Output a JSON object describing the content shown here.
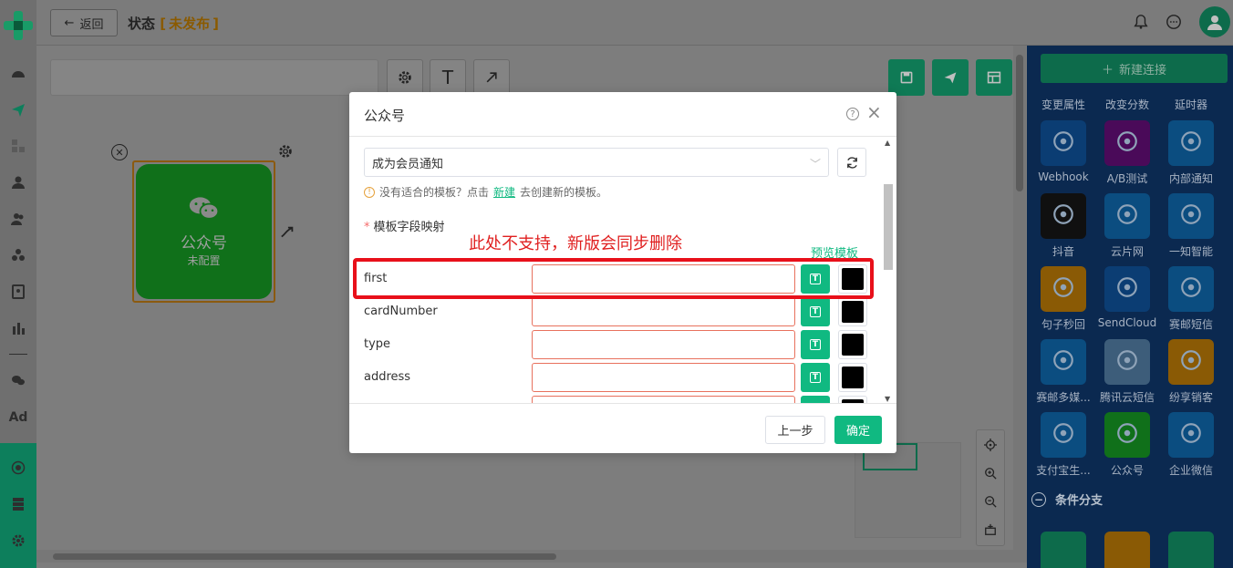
{
  "header": {
    "back_label": "返回",
    "title_prefix": "状态",
    "status_open": "[",
    "status": "未发布",
    "status_close": "]"
  },
  "rail": {
    "ad_label": "Ad"
  },
  "canvas": {
    "node": {
      "title": "公众号",
      "subtitle": "未配置"
    }
  },
  "panel": {
    "new_connection": "新建连接",
    "categories": [
      "变更属性",
      "改变分数",
      "延时器"
    ],
    "tiles": [
      {
        "label": "Webhook",
        "color": "#0b3d73",
        "icon": "webhook-icon"
      },
      {
        "label": "A/B测试",
        "color": "#4a0a59",
        "icon": "ab-test-icon"
      },
      {
        "label": "内部通知",
        "color": "#0b4d80",
        "icon": "bell-icon"
      },
      {
        "label": "抖音",
        "color": "#101010",
        "icon": "tiktok-icon"
      },
      {
        "label": "云片网",
        "color": "#0b4d80",
        "icon": "cloud-icon"
      },
      {
        "label": "一知智能",
        "color": "#0b4d80",
        "icon": "yiwise-icon"
      },
      {
        "label": "句子秒回",
        "color": "#8a5a05",
        "icon": "chat-bubble-icon"
      },
      {
        "label": "SendCloud",
        "color": "#0b3d73",
        "icon": "sendcloud-icon"
      },
      {
        "label": "赛邮短信",
        "color": "#0b4d80",
        "icon": "submail-icon"
      },
      {
        "label": "赛邮多媒...",
        "color": "#0b4d80",
        "icon": "submail-mms-icon"
      },
      {
        "label": "腾讯云短信",
        "color": "#3d5d7a",
        "icon": "tencent-cloud-icon"
      },
      {
        "label": "纷享销客",
        "color": "#8a5a05",
        "icon": "robot-icon"
      },
      {
        "label": "支付宝生...",
        "color": "#0b4d80",
        "icon": "alipay-icon"
      },
      {
        "label": "公众号",
        "color": "#10701a",
        "icon": "wechat-icon"
      },
      {
        "label": "企业微信",
        "color": "#0b4d80",
        "icon": "wecom-icon"
      }
    ],
    "section_label": "条件分支",
    "section_toggle": "−"
  },
  "dialog": {
    "title": "公众号",
    "template_value": "成为会员通知",
    "hint_prefix": "没有适合的模板？点击",
    "hint_link": "新建",
    "hint_suffix": "去创建新的模板。",
    "field_label": "模板字段映射",
    "annotation": "此处不支持，新版会同步删除",
    "preview_link": "预览模板",
    "fields": [
      {
        "label": "first",
        "value": ""
      },
      {
        "label": "cardNumber",
        "value": ""
      },
      {
        "label": "type",
        "value": ""
      },
      {
        "label": "address",
        "value": ""
      },
      {
        "label": "",
        "value": ""
      }
    ],
    "text_button_glyph": "T",
    "prev_label": "上一步",
    "ok_label": "确定"
  }
}
